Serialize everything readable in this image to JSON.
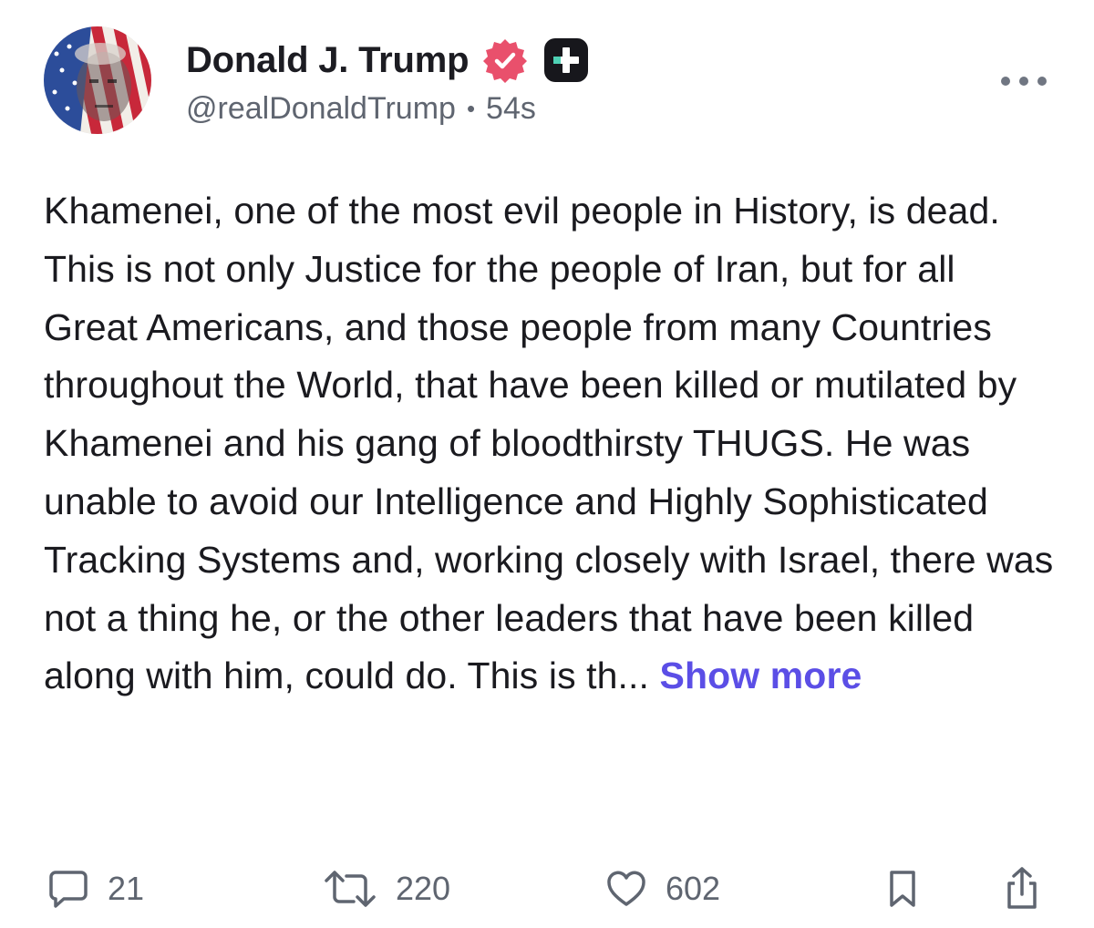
{
  "post": {
    "author": {
      "display_name": "Donald J. Trump",
      "handle": "@realDonaldTrump",
      "separator": "•",
      "timestamp": "54s",
      "verified_badge_icon": "verified-badge-icon",
      "plus_badge_icon": "plus-badge-icon",
      "badge_color": "#e9506c"
    },
    "text": "Khamenei, one of the most evil people in History, is dead. This is not only Justice for the people of Iran, but for all Great Americans, and those people from many Countries throughout the World, that have been killed or mutilated by Khamenei and his gang of bloodthirsty THUGS. He was unable to avoid our Intelligence and Highly Sophisticated Tracking Systems and, working closely with Israel, there was not a thing he, or the other leaders that have been killed along with him, could do. This is th...",
    "show_more_label": "Show more",
    "accent_color": "#5b4ee6"
  },
  "actions": {
    "reply": {
      "icon": "comment-icon",
      "count": "21"
    },
    "repost": {
      "icon": "repost-icon",
      "count": "220"
    },
    "like": {
      "icon": "heart-icon",
      "count": "602"
    },
    "bookmark": {
      "icon": "bookmark-icon"
    },
    "share": {
      "icon": "share-icon"
    }
  }
}
